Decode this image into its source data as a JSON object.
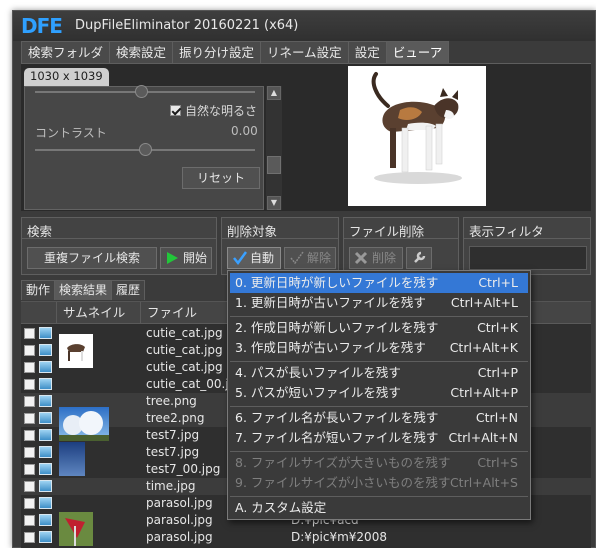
{
  "app": {
    "logo": "DFE",
    "title": "DupFileEliminator 20160221 (x64)"
  },
  "tabs": [
    {
      "label": "検索フォルダ"
    },
    {
      "label": "検索設定"
    },
    {
      "label": "振り分け設定"
    },
    {
      "label": "リネーム設定"
    },
    {
      "label": "設定"
    },
    {
      "label": "ビューア",
      "active": true
    }
  ],
  "viewer": {
    "dimensions": "1030 x 1039",
    "natural_brightness_label": "自然な明るさ",
    "natural_brightness_checked": true,
    "contrast_label": "コントラスト",
    "contrast_value": "0.00",
    "contrast_level": 0.5,
    "reset_label": "リセット"
  },
  "groups": {
    "search": {
      "title": "検索",
      "button": "重複ファイル検索",
      "start": "開始"
    },
    "delete_target": {
      "title": "削除対象",
      "auto": "自動",
      "release": "解除"
    },
    "file_delete": {
      "title": "ファイル削除",
      "delete": "削除"
    },
    "display_filter": {
      "title": "表示フィルタ"
    }
  },
  "result_tabs": [
    {
      "label": "動作"
    },
    {
      "label": "検索結果",
      "active": true
    },
    {
      "label": "履歴"
    }
  ],
  "list": {
    "columns": {
      "thumbnail": "サムネイル",
      "file": "ファイル"
    },
    "rows": [
      {
        "file": "cutie_cat.jpg",
        "path": ""
      },
      {
        "file": "cutie_cat.jpg",
        "path": ""
      },
      {
        "file": "cutie_cat.jpg",
        "path": ""
      },
      {
        "file": "cutie_cat_00.jpg",
        "path": ""
      },
      {
        "file": "tree.png",
        "path": ""
      },
      {
        "file": "tree2.png",
        "path": ""
      },
      {
        "file": "test7.jpg",
        "path": ""
      },
      {
        "file": "test7.jpg",
        "path": ""
      },
      {
        "file": "test7_00.jpg",
        "path": ""
      },
      {
        "file": "time.jpg",
        "path": ""
      },
      {
        "file": "parasol.jpg",
        "path": ""
      },
      {
        "file": "parasol.jpg",
        "path": "D:¥pic¥acd"
      },
      {
        "file": "parasol.jpg",
        "path": "D:¥pic¥m¥2008"
      }
    ]
  },
  "menu": {
    "items": [
      {
        "label": "0. 更新日時が新しいファイルを残す",
        "shortcut": "Ctrl+L",
        "selected": true
      },
      {
        "label": "1. 更新日時が古いファイルを残す",
        "shortcut": "Ctrl+Alt+L"
      },
      {
        "label": "2. 作成日時が新しいファイルを残す",
        "shortcut": "Ctrl+K"
      },
      {
        "label": "3. 作成日時が古いファイルを残す",
        "shortcut": "Ctrl+Alt+K"
      },
      {
        "label": "4. パスが長いファイルを残す",
        "shortcut": "Ctrl+P"
      },
      {
        "label": "5. パスが短いファイルを残す",
        "shortcut": "Ctrl+Alt+P"
      },
      {
        "label": "6. ファイル名が長いファイルを残す",
        "shortcut": "Ctrl+N"
      },
      {
        "label": "7. ファイル名が短いファイルを残す",
        "shortcut": "Ctrl+Alt+N"
      },
      {
        "label": "8. ファイルサイズが大きいものを残す",
        "shortcut": "Ctrl+S",
        "disabled": true
      },
      {
        "label": "9. ファイルサイズが小さいものを残す",
        "shortcut": "Ctrl+Alt+S",
        "disabled": true
      },
      {
        "label": "A. カスタム設定",
        "shortcut": ""
      }
    ]
  },
  "icons": {
    "start": "play-icon",
    "auto": "check-icon",
    "release": "check-outline-icon",
    "delete": "x-icon",
    "tool": "wrench-icon",
    "cursor": "mouse-cursor-icon"
  },
  "colors": {
    "accent": "#2fa0ff",
    "menu_highlight": "#3478d6",
    "play": "#22c63a"
  }
}
